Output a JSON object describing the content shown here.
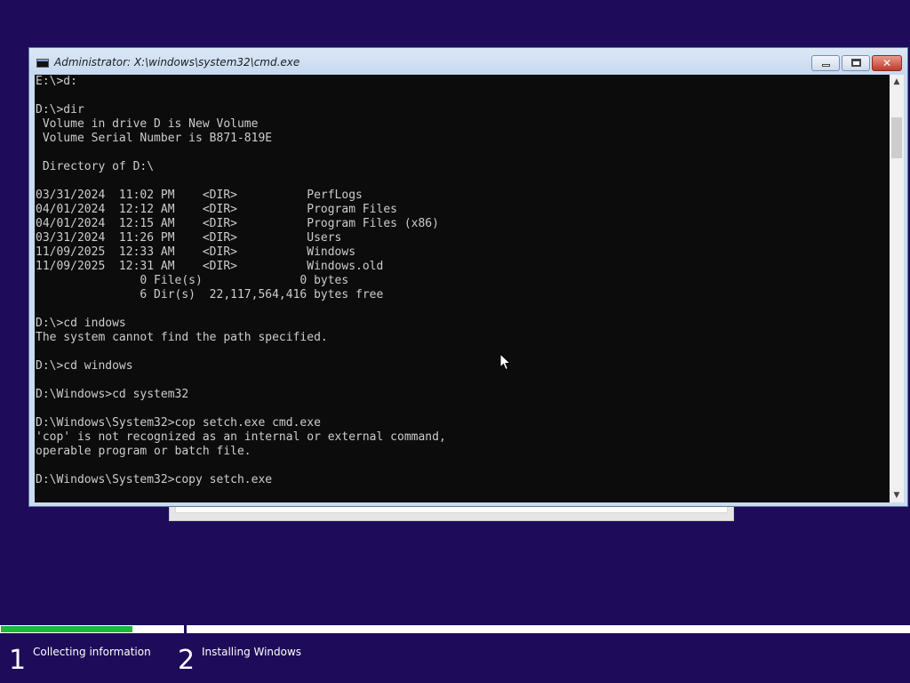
{
  "window": {
    "title": "Administrator: X:\\windows\\system32\\cmd.exe"
  },
  "console": {
    "lines": [
      "E:\\>d:",
      "",
      "D:\\>dir",
      " Volume in drive D is New Volume",
      " Volume Serial Number is B871-819E",
      "",
      " Directory of D:\\",
      "",
      "03/31/2024  11:02 PM    <DIR>          PerfLogs",
      "04/01/2024  12:12 AM    <DIR>          Program Files",
      "04/01/2024  12:15 AM    <DIR>          Program Files (x86)",
      "03/31/2024  11:26 PM    <DIR>          Users",
      "11/09/2025  12:33 AM    <DIR>          Windows",
      "11/09/2025  12:31 AM    <DIR>          Windows.old",
      "               0 File(s)              0 bytes",
      "               6 Dir(s)  22,117,564,416 bytes free",
      "",
      "D:\\>cd indows",
      "The system cannot find the path specified.",
      "",
      "D:\\>cd windows",
      "",
      "D:\\Windows>cd system32",
      "",
      "D:\\Windows\\System32>cop setch.exe cmd.exe",
      "'cop' is not recognized as an internal or external command,",
      "operable program or batch file.",
      "",
      "D:\\Windows\\System32>copy setch.exe"
    ],
    "text_color": "#cccccc",
    "background": "#0c0c0c"
  },
  "setup": {
    "progress_fraction": 0.145,
    "accent_color": "#1eb83c",
    "background": "#1e0b5a",
    "steps": [
      {
        "number": "1",
        "label": "Collecting information"
      },
      {
        "number": "2",
        "label": "Installing Windows"
      }
    ]
  },
  "icons": {
    "title": "cmd-icon",
    "minimize": "minimize-icon",
    "maximize": "maximize-icon",
    "close": "close-icon",
    "scroll_up": "chevron-up-icon",
    "scroll_down": "chevron-down-icon",
    "pointer": "mouse-pointer-icon"
  }
}
